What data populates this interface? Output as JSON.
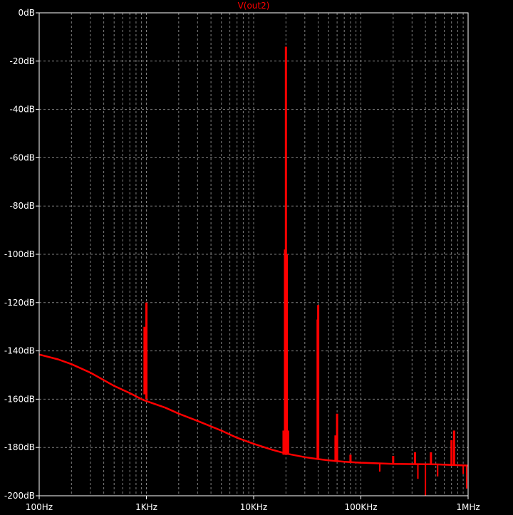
{
  "chart_data": {
    "type": "line",
    "title": "V(out2)",
    "x_scale": "log",
    "xlim": [
      100,
      1000000
    ],
    "ylim": [
      -200,
      0
    ],
    "x_ticks": [
      {
        "value": 100,
        "label": "100Hz"
      },
      {
        "value": 1000,
        "label": "1KHz"
      },
      {
        "value": 10000,
        "label": "10KHz"
      },
      {
        "value": 100000,
        "label": "100KHz"
      },
      {
        "value": 1000000,
        "label": "1MHz"
      }
    ],
    "y_ticks": [
      {
        "value": 0,
        "label": "0dB"
      },
      {
        "value": -20,
        "label": "-20dB"
      },
      {
        "value": -40,
        "label": "-40dB"
      },
      {
        "value": -60,
        "label": "-60dB"
      },
      {
        "value": -80,
        "label": "-80dB"
      },
      {
        "value": -100,
        "label": "-100dB"
      },
      {
        "value": -120,
        "label": "-120dB"
      },
      {
        "value": -140,
        "label": "-140dB"
      },
      {
        "value": -160,
        "label": "-160dB"
      },
      {
        "value": -180,
        "label": "-180dB"
      },
      {
        "value": -200,
        "label": "-200dB"
      }
    ],
    "grid": true,
    "colors": {
      "background": "#000000",
      "trace": "#ff0000",
      "grid": "#808080",
      "text": "#ffffff",
      "title": "#ff0000"
    },
    "series": [
      {
        "name": "V(out2)",
        "baseline": [
          [
            100,
            -141.5
          ],
          [
            150,
            -143.5
          ],
          [
            200,
            -145.5
          ],
          [
            300,
            -149
          ],
          [
            500,
            -154.5
          ],
          [
            700,
            -157.5
          ],
          [
            900,
            -160
          ],
          [
            1000,
            -160.8
          ],
          [
            1500,
            -163.5
          ],
          [
            2000,
            -166
          ],
          [
            3000,
            -169
          ],
          [
            5000,
            -173
          ],
          [
            7000,
            -176
          ],
          [
            10000,
            -178.5
          ],
          [
            15000,
            -181
          ],
          [
            20000,
            -182.5
          ],
          [
            30000,
            -184
          ],
          [
            40000,
            -184.8
          ],
          [
            50000,
            -185.3
          ],
          [
            70000,
            -185.9
          ],
          [
            100000,
            -186.3
          ],
          [
            200000,
            -186.8
          ],
          [
            500000,
            -187
          ],
          [
            1000000,
            -187.5
          ]
        ],
        "spikes": [
          {
            "f": 960,
            "level": -158,
            "peak": -130
          },
          {
            "f": 1000,
            "level": -160,
            "peak": -120
          },
          {
            "f": 19000,
            "level": -183,
            "peak": -173
          },
          {
            "f": 19600,
            "level": -183,
            "peak": -98
          },
          {
            "f": 20000,
            "level": -183,
            "peak": -14
          },
          {
            "f": 20400,
            "level": -183,
            "peak": -100
          },
          {
            "f": 21000,
            "level": -183,
            "peak": -173
          },
          {
            "f": 39500,
            "level": -185,
            "peak": -127
          },
          {
            "f": 40000,
            "level": -185,
            "peak": -121
          },
          {
            "f": 58000,
            "level": -186,
            "peak": -175
          },
          {
            "f": 60000,
            "level": -186,
            "peak": -166
          },
          {
            "f": 80000,
            "level": -186.2,
            "peak": -183
          },
          {
            "f": 200000,
            "level": -186.8,
            "peak": -183.5
          },
          {
            "f": 320000,
            "level": -187,
            "peak": -182
          },
          {
            "f": 450000,
            "level": -187,
            "peak": -182
          },
          {
            "f": 700000,
            "level": -187.2,
            "peak": -177
          },
          {
            "f": 740000,
            "level": -187.2,
            "peak": -173
          }
        ],
        "dips": [
          {
            "f": 150000,
            "level": -186.6,
            "trough": -190
          },
          {
            "f": 340000,
            "level": -187,
            "trough": -193
          },
          {
            "f": 400000,
            "level": -187,
            "trough": -200
          },
          {
            "f": 520000,
            "level": -187.1,
            "trough": -192
          },
          {
            "f": 900000,
            "level": -187.4,
            "trough": -191
          },
          {
            "f": 970000,
            "level": -187.5,
            "trough": -197
          }
        ]
      }
    ]
  }
}
